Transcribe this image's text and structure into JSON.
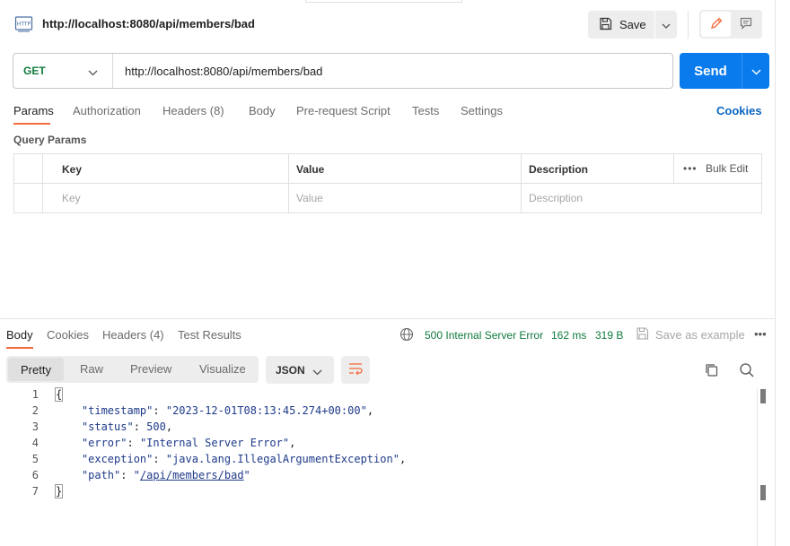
{
  "request": {
    "title": "http://localhost:8080/api/members/bad",
    "save_label": "Save",
    "method": "GET",
    "url": "http://localhost:8080/api/members/bad",
    "send_label": "Send",
    "icon_name": "http-icon"
  },
  "request_tabs": [
    {
      "label": "Params",
      "active": true
    },
    {
      "label": "Authorization",
      "active": false
    },
    {
      "label": "Headers (8)",
      "active": false
    },
    {
      "label": "Body",
      "active": false
    },
    {
      "label": "Pre-request Script",
      "active": false
    },
    {
      "label": "Tests",
      "active": false
    },
    {
      "label": "Settings",
      "active": false
    }
  ],
  "cookies_label": "Cookies",
  "query_params": {
    "title": "Query Params",
    "columns": [
      "Key",
      "Value",
      "Description"
    ],
    "bulk_edit": "Bulk Edit",
    "more": "•••",
    "placeholders": [
      "Key",
      "Value",
      "Description"
    ]
  },
  "response": {
    "tabs": [
      {
        "label": "Body",
        "active": true
      },
      {
        "label": "Cookies",
        "active": false
      },
      {
        "label": "Headers (4)",
        "active": false
      },
      {
        "label": "Test Results",
        "active": false
      }
    ],
    "status": "500 Internal Server Error",
    "time": "162 ms",
    "size": "319 B",
    "save_as_example": "Save as example",
    "more": "•••",
    "formats": [
      "Pretty",
      "Raw",
      "Preview",
      "Visualize"
    ],
    "selected_format": "Pretty",
    "language": "JSON",
    "lines": [
      {
        "num": "1",
        "text": "{"
      },
      {
        "num": "2",
        "key": "\"timestamp\"",
        "value": "\"2023-12-01T08:13:45.274+00:00\"",
        "trail": ","
      },
      {
        "num": "3",
        "key": "\"status\"",
        "value": "500",
        "trail": ","
      },
      {
        "num": "4",
        "key": "\"error\"",
        "value": "\"Internal Server Error\"",
        "trail": ","
      },
      {
        "num": "5",
        "key": "\"exception\"",
        "value": "\"java.lang.IllegalArgumentException\"",
        "trail": ","
      },
      {
        "num": "6",
        "key": "\"path\"",
        "value_prefix": "\"",
        "value_link": "/api/members/bad",
        "value_suffix": "\"",
        "trail": ""
      },
      {
        "num": "7",
        "text": "}"
      }
    ]
  },
  "colors": {
    "accent": "#097bed",
    "tab_underline": "#f26b3a",
    "status_green": "#0f7a3c",
    "method_green": "#0f7a3c"
  }
}
